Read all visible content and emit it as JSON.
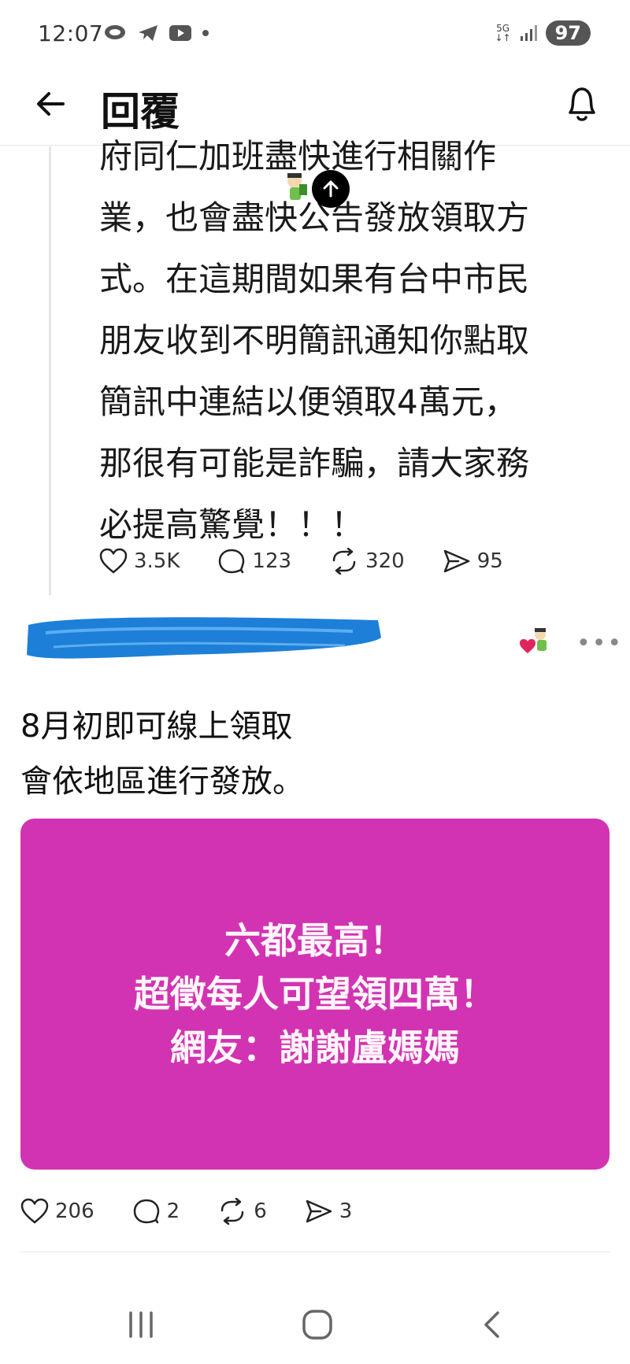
{
  "status_bar": {
    "time": "12:07",
    "network_label": "5G",
    "battery": "97",
    "icons": [
      "messaging-icon",
      "telegram-icon",
      "youtube-icon",
      "dot-icon",
      "signal-icon"
    ]
  },
  "header": {
    "title": "回覆",
    "back_icon": "arrow-left-icon",
    "bell_icon": "bell-icon"
  },
  "post1": {
    "text": "府同仁加班盡快進行相關作\n業，也會盡快公告發放領取方\n式。在這期間如果有台中市民\n朋友收到不明簡訊通知你點取\n簡訊中連結以便領取4萬元，\n那很有可能是詐騙，請大家務\n必提高驚覺！！！",
    "likes": "3.5K",
    "comments": "123",
    "reposts": "320",
    "shares": "95"
  },
  "post2": {
    "text_line1": "8月初即可線上領取",
    "text_line2": "會依地區進行發放。",
    "promo_lines": [
      "六都最高！",
      "超徵每人可望領四萬！",
      "網友：謝謝盧媽媽"
    ],
    "likes": "206",
    "comments": "2",
    "reposts": "6",
    "shares": "3",
    "promo_color": "#d233b2",
    "redaction_color": "#1e7fd8"
  },
  "nav": {
    "recent_icon": "recent-apps-icon",
    "home_icon": "home-icon",
    "back_icon": "back-icon"
  }
}
